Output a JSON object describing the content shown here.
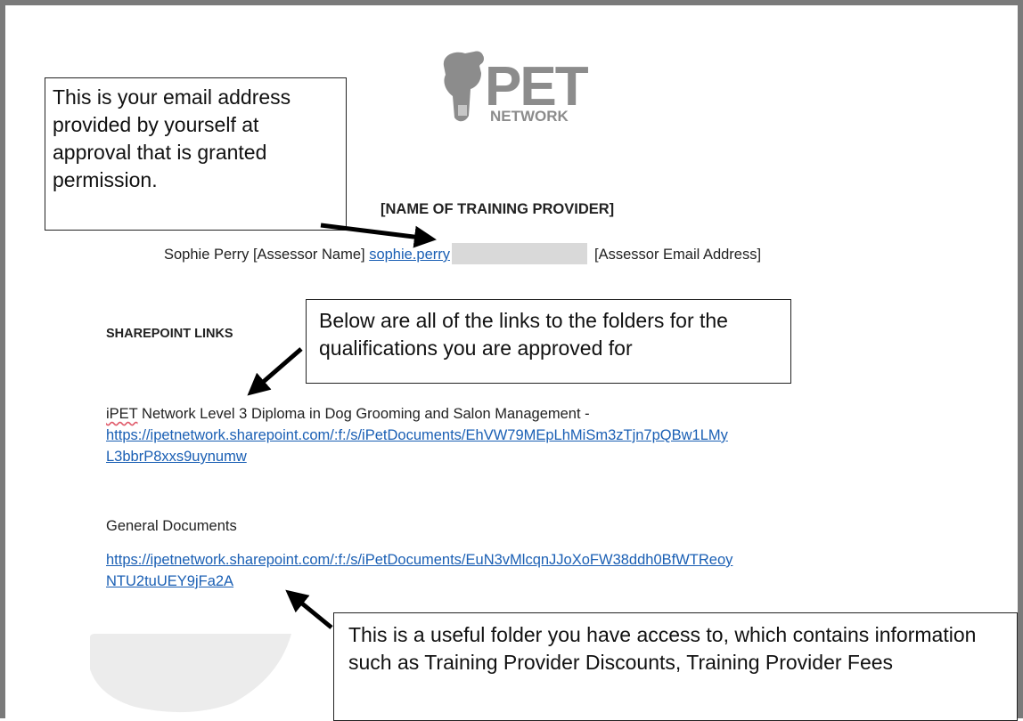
{
  "logo": {
    "big_text": "PET",
    "small_text": "NETWORK",
    "colors": {
      "logo_gray": "#8c8c8c"
    }
  },
  "document": {
    "provider_heading": "[NAME OF TRAINING PROVIDER]",
    "assessor_name": "Sophie Perry [Assessor Name]",
    "assessor_email_link": "sophie.perry",
    "assessor_email_label": "[Assessor Email Address]",
    "sharepoint_heading": "SHAREPOINT LINKS",
    "qualification_prefix": "iPET",
    "qualification_rest": " Network Level 3 Diploma in Dog Grooming and Salon Management -",
    "qualification_link_line1": "https://ipetnetwork.sharepoint.com/:f:/s/iPetDocuments/EhVW79MEpLhMiSm3zTjn7pQBw1LMy",
    "qualification_link_line2": "L3bbrP8xxs9uynumw",
    "general_heading": "General Documents",
    "general_link_line1": "https://ipetnetwork.sharepoint.com/:f:/s/iPetDocuments/EuN3vMlcqnJJoXoFW38ddh0BfWTReoy",
    "general_link_line2": "NTU2tuUEY9jFa2A"
  },
  "callouts": {
    "email_note": "This is your email address provided by yourself at approval that is granted permission.",
    "links_note": "Below are all of the links to the folders for the qualifications you are approved for",
    "folder_note": "This is a useful folder you have access to, which contains information such as Training Provider Discounts, Training Provider Fees"
  },
  "colors": {
    "link": "#1a5fb4",
    "frame": "#7a7a7a",
    "redaction": "#d9d9d9",
    "spellcheck": "#e05a6a"
  }
}
